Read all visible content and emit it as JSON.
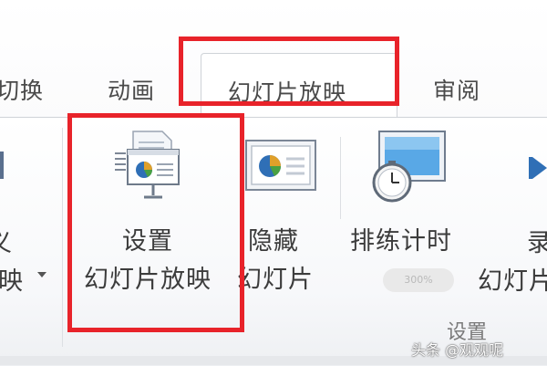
{
  "tabs": {
    "transitions_partial": "切换",
    "animations": "动画",
    "slideshow": "幻灯片放映",
    "review": "审阅"
  },
  "buttons": {
    "left_partial_line1": "义",
    "left_partial_line2": "映",
    "setup_line1": "设置",
    "setup_line2": "幻灯片放映",
    "hide_line1": "隐藏",
    "hide_line2": "幻灯片",
    "rehearse": "排练计时",
    "record_partial_line1": "录",
    "record_partial_line2": "幻灯片"
  },
  "group": {
    "setup_label": "设置"
  },
  "zoom": {
    "label": "300%"
  },
  "watermark": {
    "text": "头条 @观观呢"
  },
  "colors": {
    "highlight": "#e8232a",
    "accent_blue": "#2f6fb6"
  }
}
